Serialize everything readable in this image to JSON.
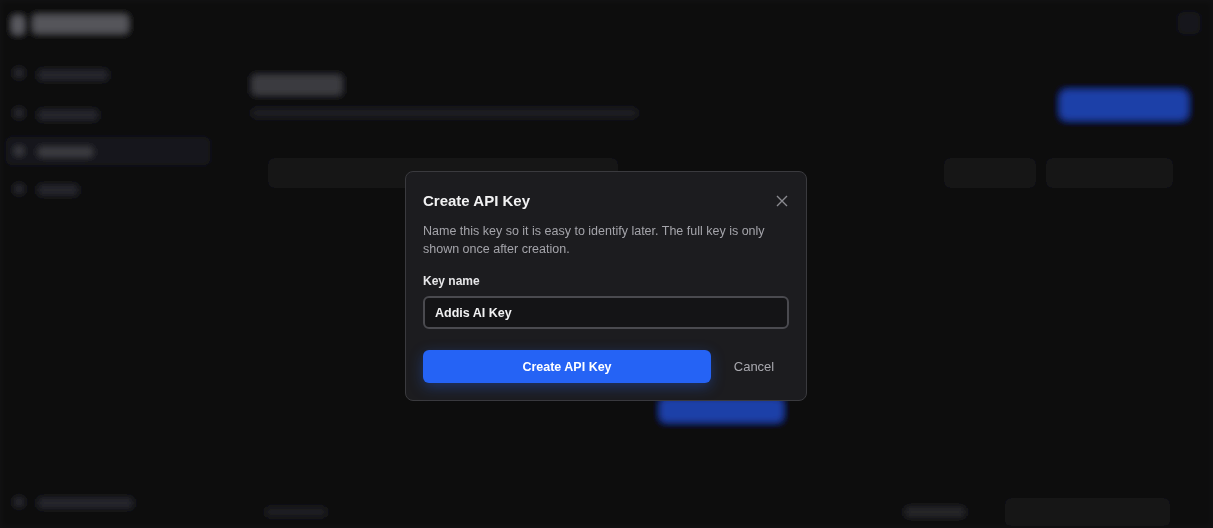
{
  "dialog": {
    "title": "Create API Key",
    "description": "Name this key so it is easy to identify later. The full key is only shown once after creation.",
    "field": {
      "label": "Key name",
      "value": "Addis AI Key"
    },
    "buttons": [
      {
        "label": "Create API Key",
        "kind": "primary"
      },
      {
        "label": "Cancel",
        "kind": "secondary"
      }
    ]
  }
}
